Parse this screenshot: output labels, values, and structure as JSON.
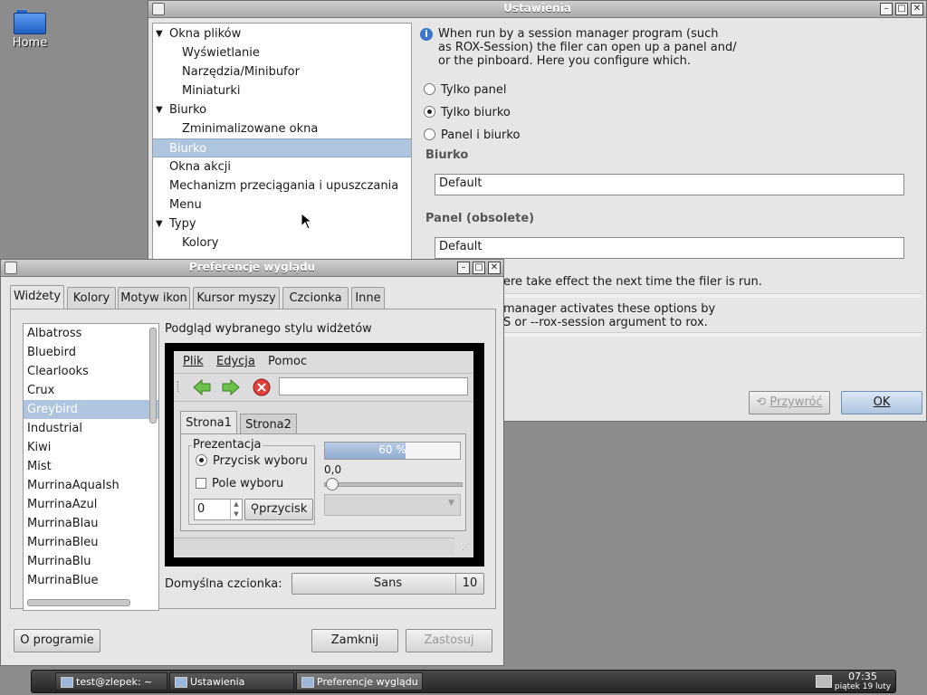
{
  "desktop": {
    "home_label": "Home"
  },
  "settings": {
    "title": "Ustawienia",
    "tree": [
      {
        "label": "Okna plików",
        "arrow": "▼"
      },
      {
        "label": "Wyświetlanie",
        "arrow": ""
      },
      {
        "label": "Narzędzia/Minibufor",
        "arrow": ""
      },
      {
        "label": "Miniaturki",
        "arrow": ""
      },
      {
        "label": "Biurko",
        "arrow": "▼"
      },
      {
        "label": "Zminimalizowane okna",
        "arrow": ""
      },
      {
        "label": "Biurko",
        "arrow": ""
      },
      {
        "label": "Okna akcji",
        "arrow": ""
      },
      {
        "label": "Mechanizm przeciągania i upuszczania",
        "arrow": ""
      },
      {
        "label": "Menu",
        "arrow": ""
      },
      {
        "label": "Typy",
        "arrow": "▼"
      },
      {
        "label": "Kolory",
        "arrow": ""
      }
    ],
    "info_line1": "When run by a session manager program (such",
    "info_line2": "as ROX-Session) the filer can open up a panel and/",
    "info_line3": "or the pinboard.  Here you configure which.",
    "radio_panel": "Tylko panel",
    "radio_desk": "Tylko biurko",
    "radio_both": "Panel i biurko",
    "section_desk": "Biurko",
    "desk_value": "Default",
    "section_panel": "Panel (obsolete)",
    "panel_value": "Default",
    "note1": "ere take effect the next time the filer is run.",
    "note2": "manager activates these options by",
    "note3": "S or --rox-session argument to rox.",
    "revert": "Przywróć",
    "ok": "OK"
  },
  "prefs": {
    "title": "Preferencje wyglądu",
    "tabs": [
      "Widżety",
      "Kolory",
      "Motyw ikon",
      "Kursor myszy",
      "Czcionka",
      "Inne"
    ],
    "themes": [
      "Albatross",
      "Bluebird",
      "Clearlooks",
      "Crux",
      "Greybird",
      "Industrial",
      "Kiwi",
      "Mist",
      "MurrinaAquaIsh",
      "MurrinaAzul",
      "MurrinaBlau",
      "MurrinaBleu",
      "MurrinaBlu",
      "MurrinaBlue"
    ],
    "preview_heading": "Podgląd wybranego stylu widżetów",
    "preview": {
      "menu_file": "Plik",
      "menu_edit": "Edycja",
      "menu_help": "Pomoc",
      "tab1": "Strona1",
      "tab2": "Strona2",
      "group": "Prezentacja",
      "radio": "Przycisk wyboru",
      "checkbox": "Pole wyboru",
      "progress_text": "60 %",
      "progress": 0.6,
      "slider_value": "0,0",
      "spin_value": "0",
      "button": "przycisk"
    },
    "font_label": "Domyślna czcionka:",
    "font_name": "Sans",
    "font_size": "10",
    "about": "O programie",
    "close": "Zamknij",
    "apply": "Zastosuj"
  },
  "taskbar": {
    "tasks": [
      "test@zlepek: ~",
      "Ustawienia",
      "Preferencje wyglądu"
    ],
    "time": "07:35",
    "date": "piątek 19 luty"
  }
}
